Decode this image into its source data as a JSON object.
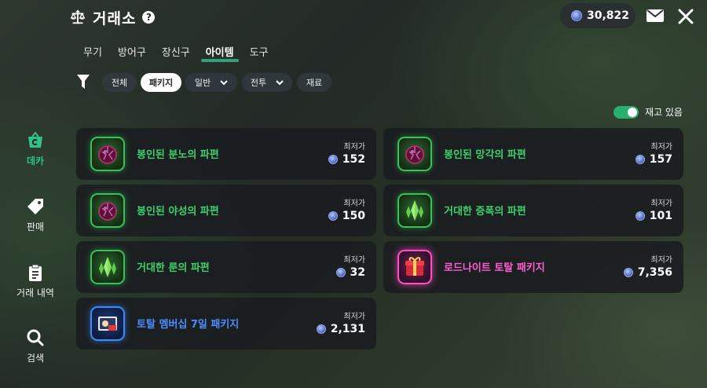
{
  "header": {
    "title": "거래소",
    "help_label": "?",
    "currency": "30,822",
    "icons": {
      "title": "scales-icon",
      "mail": "mail-icon",
      "close": "close-icon",
      "currency": "crystal-coin-icon"
    }
  },
  "tabs": [
    {
      "label": "무기"
    },
    {
      "label": "방어구"
    },
    {
      "label": "장신구"
    },
    {
      "label": "아이템",
      "active": true
    },
    {
      "label": "도구"
    }
  ],
  "filters": {
    "chips": [
      {
        "label": "전체"
      },
      {
        "label": "패키지",
        "active": true
      },
      {
        "label": "일반",
        "dropdown": true
      },
      {
        "label": "전투",
        "dropdown": true
      },
      {
        "label": "재료"
      }
    ]
  },
  "stock_toggle": {
    "label": "재고 있음",
    "on": true
  },
  "sidebar": [
    {
      "label": "데카",
      "icon": "shopping-basket-icon",
      "active": true
    },
    {
      "label": "판매",
      "icon": "price-tag-icon"
    },
    {
      "label": "거래 내역",
      "icon": "clipboard-icon"
    },
    {
      "label": "검색",
      "icon": "search-icon"
    }
  ],
  "items": [
    {
      "name": "봉인된 분노의 파편",
      "price_label": "최저가",
      "price": "152",
      "rarity": "green",
      "icon": "sealed-orb-icon"
    },
    {
      "name": "봉인된 망각의 파편",
      "price_label": "최저가",
      "price": "157",
      "rarity": "green",
      "icon": "sealed-orb-icon"
    },
    {
      "name": "봉인된 야성의 파편",
      "price_label": "최저가",
      "price": "150",
      "rarity": "green",
      "icon": "sealed-orb-icon"
    },
    {
      "name": "거대한 증폭의 파편",
      "price_label": "최저가",
      "price": "101",
      "rarity": "green",
      "icon": "crystal-shard-icon"
    },
    {
      "name": "거대한 룬의 파편",
      "price_label": "최저가",
      "price": "32",
      "rarity": "green",
      "icon": "crystal-shard-icon"
    },
    {
      "name": "로드나이트 토탈 패키지",
      "price_label": "최저가",
      "price": "7,356",
      "rarity": "pink",
      "icon": "gift-box-icon"
    },
    {
      "name": "토탈 멤버십 7일 패키지",
      "price_label": "최저가",
      "price": "2,131",
      "rarity": "blue",
      "icon": "membership-ticket-icon"
    }
  ],
  "colors": {
    "accent": "#2ea37a",
    "green_name": "#3fcf6c",
    "pink_name": "#ff5ccf",
    "blue_name": "#4d8dff",
    "toggle_on": "#29b06f"
  }
}
